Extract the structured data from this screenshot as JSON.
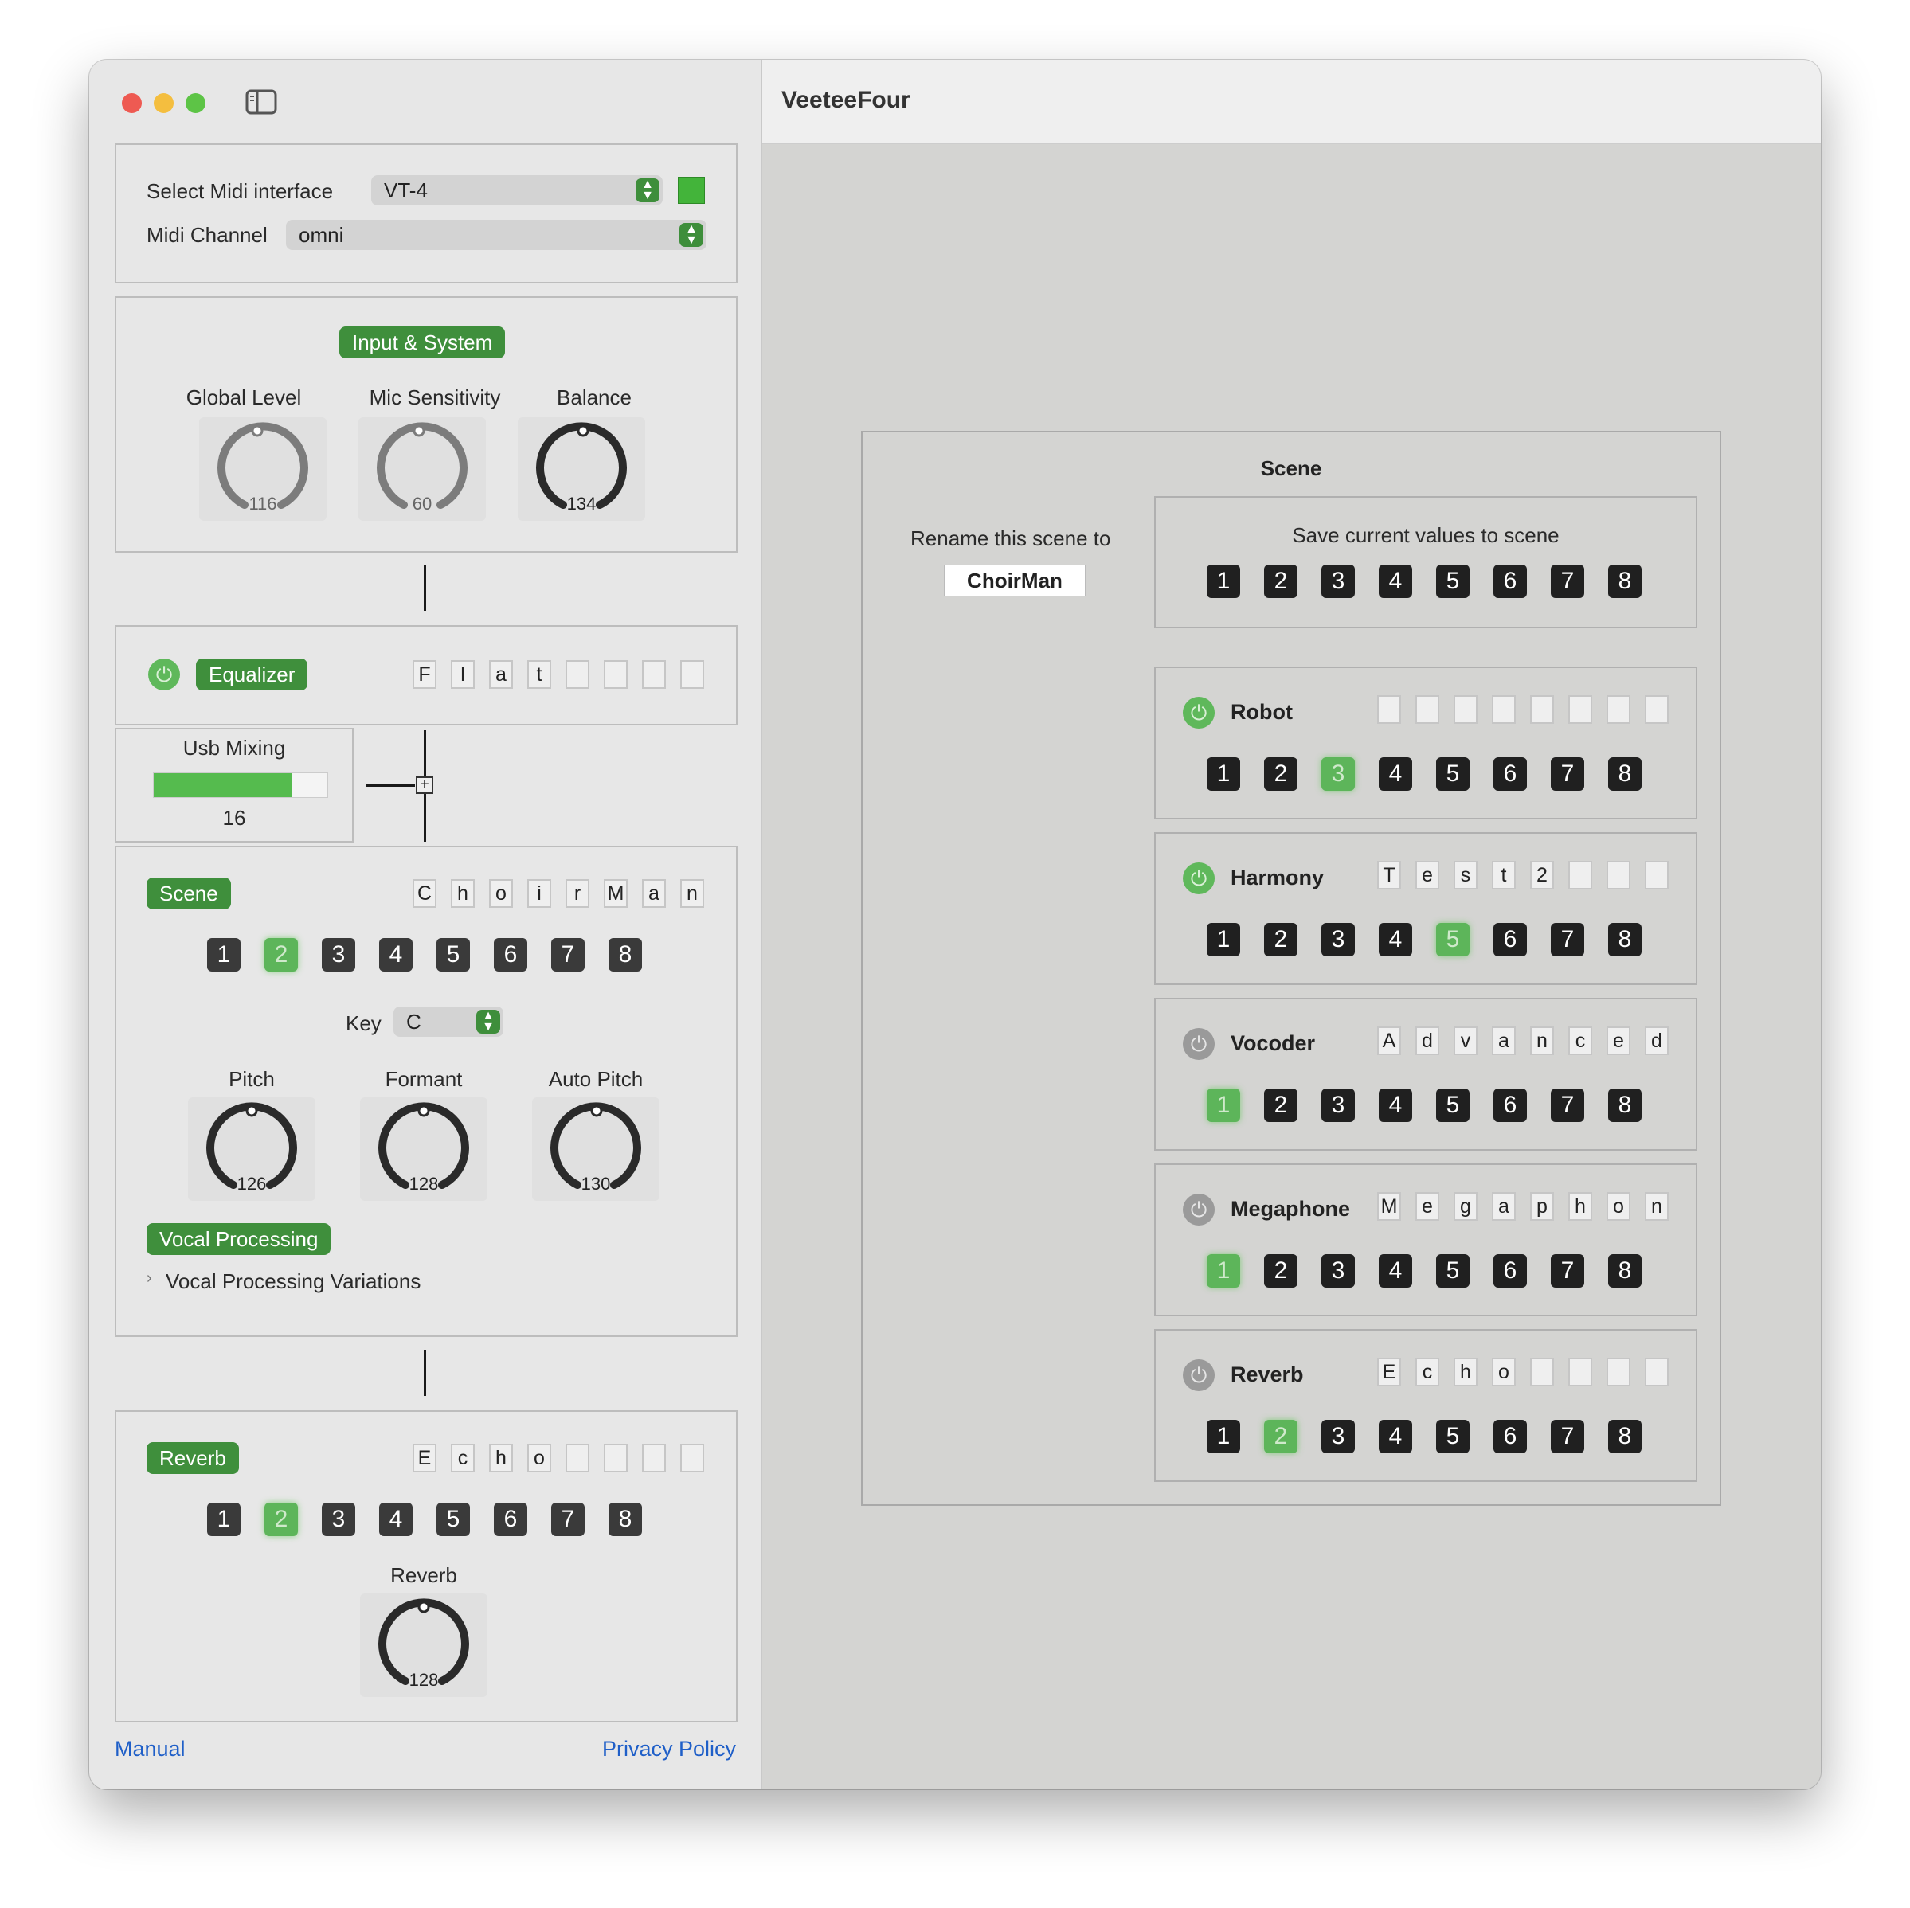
{
  "window": {
    "title": "VeeteeFour"
  },
  "midi": {
    "interface_label": "Select Midi interface",
    "interface_value": "VT-4",
    "channel_label": "Midi Channel",
    "channel_value": "omni",
    "status_color": "#43b43a"
  },
  "input_system": {
    "title": "Input & System",
    "knobs": [
      {
        "label": "Global Level",
        "value": "116"
      },
      {
        "label": "Mic Sensitivity",
        "value": "60"
      },
      {
        "label": "Balance",
        "value": "134"
      }
    ]
  },
  "equalizer": {
    "label": "Equalizer",
    "name_chars": [
      "F",
      "l",
      "a",
      "t",
      "",
      "",
      "",
      ""
    ]
  },
  "usb_mixing": {
    "label": "Usb Mixing",
    "value": "16",
    "level": 0.8
  },
  "scene_panel": {
    "label": "Scene",
    "name_chars": [
      "C",
      "h",
      "o",
      "i",
      "r",
      "M",
      "a",
      "n"
    ],
    "numbers": [
      "1",
      "2",
      "3",
      "4",
      "5",
      "6",
      "7",
      "8"
    ],
    "active": "2",
    "key_label": "Key",
    "key_value": "C",
    "knobs": [
      {
        "label": "Pitch",
        "value": "126"
      },
      {
        "label": "Formant",
        "value": "128"
      },
      {
        "label": "Auto Pitch",
        "value": "130"
      }
    ],
    "vocal_processing": "Vocal Processing",
    "variations": "Vocal Processing Variations"
  },
  "reverb_panel": {
    "label": "Reverb",
    "name_chars": [
      "E",
      "c",
      "h",
      "o",
      "",
      "",
      "",
      ""
    ],
    "numbers": [
      "1",
      "2",
      "3",
      "4",
      "5",
      "6",
      "7",
      "8"
    ],
    "active": "2",
    "knob": {
      "label": "Reverb",
      "value": "128"
    }
  },
  "footer": {
    "manual": "Manual",
    "privacy": "Privacy Policy"
  },
  "scene_editor": {
    "title": "Scene",
    "rename_label": "Rename this scene to",
    "rename_value": "ChoirMan",
    "save_label": "Save current values to scene",
    "save_numbers": [
      "1",
      "2",
      "3",
      "4",
      "5",
      "6",
      "7",
      "8"
    ],
    "effects": [
      {
        "name": "Robot",
        "on": true,
        "chars": [
          "",
          "",
          "",
          "",
          "",
          "",
          "",
          ""
        ],
        "active": "3"
      },
      {
        "name": "Harmony",
        "on": true,
        "chars": [
          "T",
          "e",
          "s",
          "t",
          "2",
          "",
          "",
          ""
        ],
        "active": "5"
      },
      {
        "name": "Vocoder",
        "on": false,
        "chars": [
          "A",
          "d",
          "v",
          "a",
          "n",
          "c",
          "e",
          "d"
        ],
        "active": "1"
      },
      {
        "name": "Megaphone",
        "on": false,
        "chars": [
          "M",
          "e",
          "g",
          "a",
          "p",
          "h",
          "o",
          "n"
        ],
        "active": "1"
      },
      {
        "name": "Reverb",
        "on": false,
        "chars": [
          "E",
          "c",
          "h",
          "o",
          "",
          "",
          "",
          ""
        ],
        "active": "2"
      }
    ]
  }
}
